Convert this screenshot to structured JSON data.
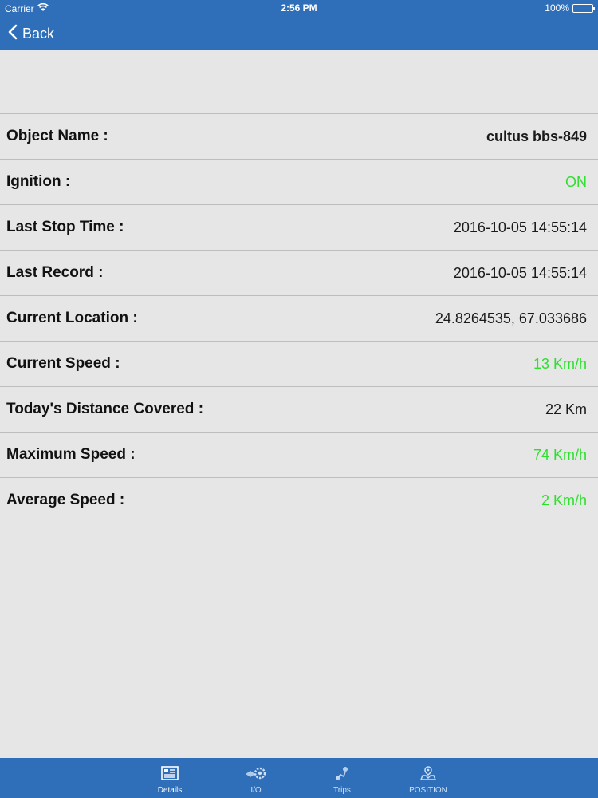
{
  "status_bar": {
    "carrier": "Carrier",
    "time": "2:56 PM",
    "battery": "100%",
    "battery_level": 1.0
  },
  "nav": {
    "back_label": "Back"
  },
  "details": [
    {
      "label": "Object Name :",
      "value": "cultus bbs-849",
      "style": "bold"
    },
    {
      "label": "Ignition :",
      "value": "ON",
      "style": "green"
    },
    {
      "label": "Last Stop Time :",
      "value": "2016-10-05 14:55:14",
      "style": "normal"
    },
    {
      "label": "Last Record :",
      "value": "2016-10-05 14:55:14",
      "style": "normal"
    },
    {
      "label": "Current Location :",
      "value": "24.8264535, 67.033686",
      "style": "normal"
    },
    {
      "label": "Current Speed :",
      "value": "13 Km/h",
      "style": "green"
    },
    {
      "label": "Today's Distance Covered :",
      "value": "22 Km",
      "style": "normal"
    },
    {
      "label": "Maximum Speed :",
      "value": "74 Km/h",
      "style": "green"
    },
    {
      "label": "Average Speed :",
      "value": "2 Km/h",
      "style": "green"
    }
  ],
  "tabs": [
    {
      "label": "Details",
      "icon": "details-icon",
      "active": true
    },
    {
      "label": "I/O",
      "icon": "io-icon",
      "active": false
    },
    {
      "label": "Trips",
      "icon": "trips-icon",
      "active": false
    },
    {
      "label": "POSITION",
      "icon": "position-icon",
      "active": false
    }
  ],
  "colors": {
    "bar_blue": "#2f6eb8",
    "background": "#e6e6e6",
    "value_green": "#2ee02e"
  }
}
